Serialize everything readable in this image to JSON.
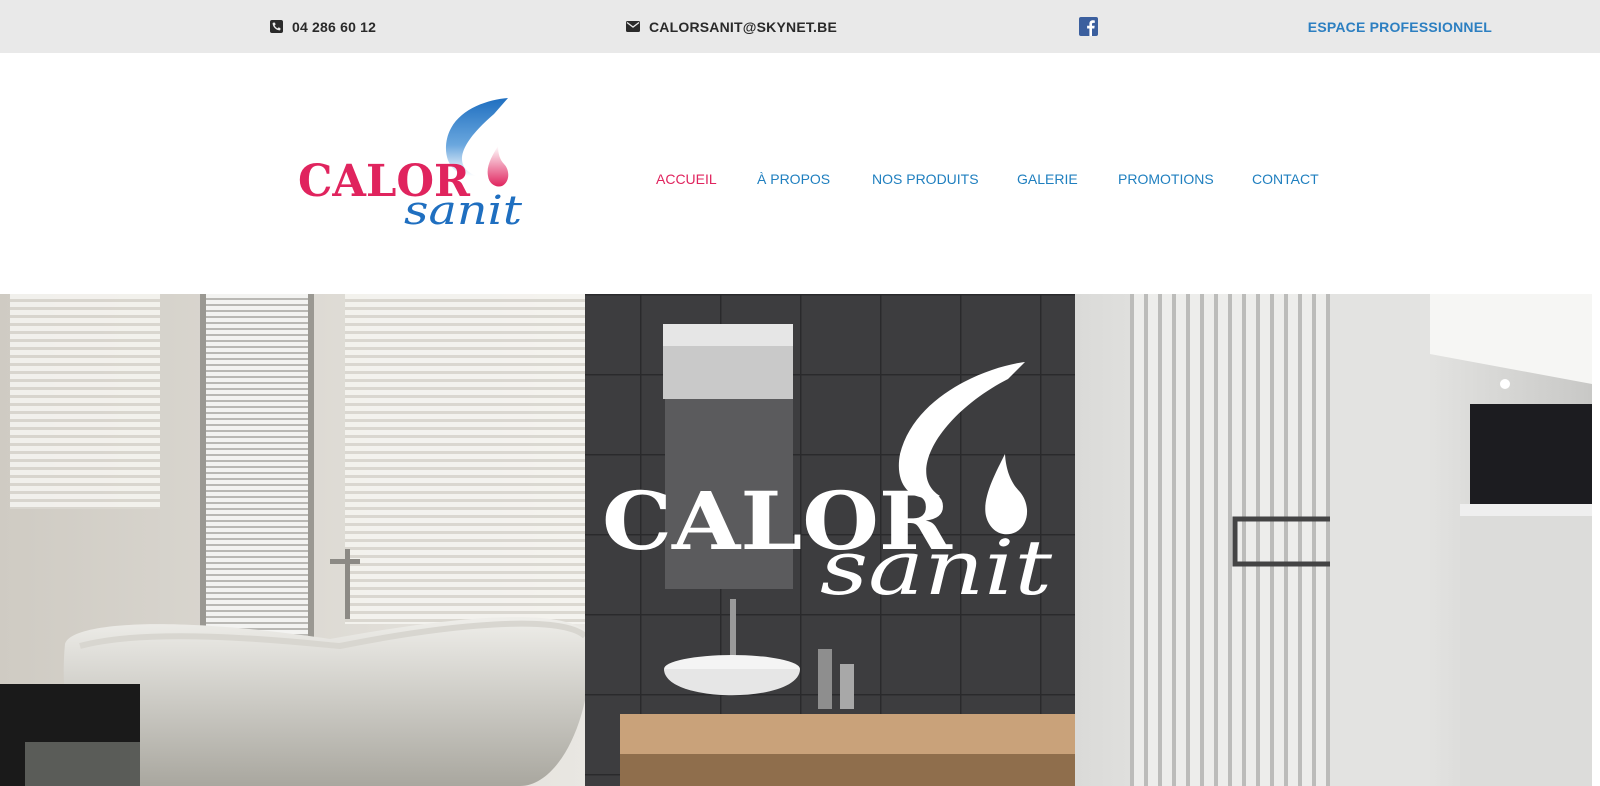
{
  "topbar": {
    "phone": "04 286 60 12",
    "email": "CALORSANIT@SKYNET.BE",
    "facebook_icon": "facebook-icon",
    "pro_link": "ESPACE PROFESSIONNEL"
  },
  "logo": {
    "word1": "CALOR",
    "word2": "sanit"
  },
  "nav": {
    "items": [
      {
        "label": "ACCUEIL",
        "active": true
      },
      {
        "label": "À PROPOS",
        "active": false
      },
      {
        "label": "NOS PRODUITS",
        "active": false
      },
      {
        "label": "GALERIE",
        "active": false
      },
      {
        "label": "PROMOTIONS",
        "active": false
      },
      {
        "label": "CONTACT",
        "active": false
      }
    ]
  },
  "hero": {
    "logo_word1": "CALOR",
    "logo_word2": "sanit"
  },
  "colors": {
    "brand_red": "#e0245e",
    "brand_blue": "#1f7fbf",
    "pro_blue": "#2c7fc1",
    "topbar_bg": "#e9e9e9"
  }
}
